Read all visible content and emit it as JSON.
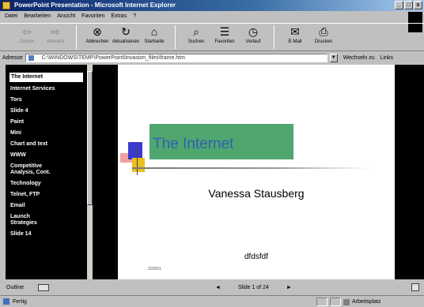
{
  "window": {
    "title": "PowerPoint Presentation - Microsoft Internet Explorer",
    "buttons": [
      "_",
      "□",
      "x"
    ]
  },
  "menu": [
    "Datei",
    "Bearbeiten",
    "Ansicht",
    "Favoriten",
    "Extras",
    "?"
  ],
  "toolbar": [
    {
      "label": "Zurück",
      "icon": "back-arrow-icon",
      "glyph": "⇦",
      "enabled": false
    },
    {
      "label": "Vorwärts",
      "icon": "forward-arrow-icon",
      "glyph": "⇨",
      "enabled": false
    },
    {
      "label": "Abbrechen",
      "icon": "stop-icon",
      "glyph": "⊗",
      "enabled": true
    },
    {
      "label": "Aktualisieren",
      "icon": "refresh-icon",
      "glyph": "↻",
      "enabled": true
    },
    {
      "label": "Startseite",
      "icon": "home-icon",
      "glyph": "⌂",
      "enabled": true
    },
    {
      "label": "Suchen",
      "icon": "search-icon",
      "glyph": "⌕",
      "enabled": true
    },
    {
      "label": "Favoriten",
      "icon": "favorites-icon",
      "glyph": "☰",
      "enabled": true
    },
    {
      "label": "Verlauf",
      "icon": "history-icon",
      "glyph": "◷",
      "enabled": true
    },
    {
      "label": "E-Mail",
      "icon": "mail-icon",
      "glyph": "✉",
      "enabled": true
    },
    {
      "label": "Drucken",
      "icon": "print-icon",
      "glyph": "⎙",
      "enabled": true
    }
  ],
  "address": {
    "label": "Adresse",
    "value": "C:\\WINDOWS\\TEMP\\PowerPoint\\Invasion_files\\frame.htm",
    "go": "Wechseln zu",
    "links": "Links"
  },
  "outline": {
    "items": [
      "The Internet",
      "Internet Services",
      "Tors",
      "Slide 4",
      "Paint",
      "Mini",
      "Chart and text",
      "WWW",
      "Competitive\nAnalysis, Cont.",
      "Technology",
      "Telnet, FTP",
      "Email",
      "Launch\nStrategies",
      "Slide 14"
    ],
    "active_index": 0
  },
  "slide": {
    "title": "The Internet",
    "subtitle": "Vanessa Stausberg",
    "body": "dfdsfdf",
    "date": "3/20/01"
  },
  "bottom": {
    "outline_label": "Outline",
    "prev": "◄",
    "counter": "Slide 1 of 24",
    "next": "►"
  },
  "status": {
    "left": "Fertig",
    "zone": "Arbeitsplatz"
  },
  "colors": {
    "titlebar": "#0a246a",
    "title_box": "#4fa66f",
    "title_text": "#2f60b0"
  }
}
